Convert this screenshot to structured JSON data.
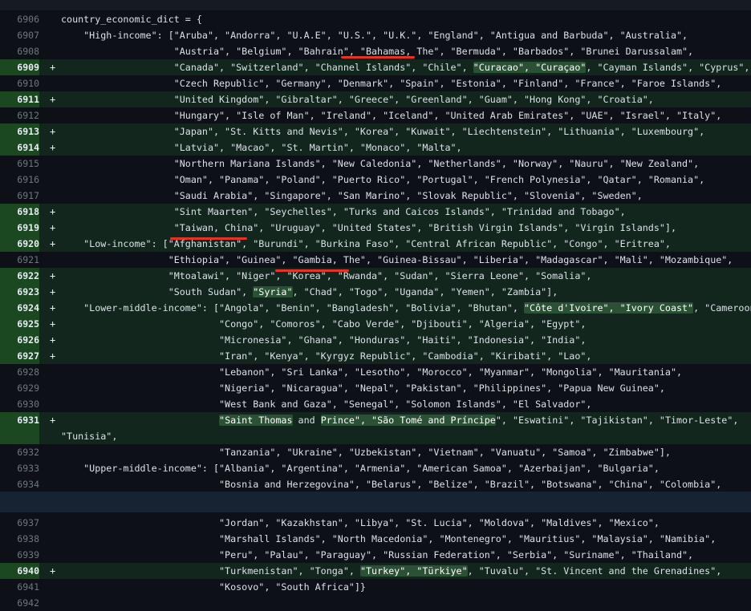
{
  "theme": {
    "bg": "#0d1117",
    "added_row_bg": "#12261e",
    "added_gutter_bg": "#1b4721",
    "inline_highlight_bg": "#2a5134",
    "line_number_color": "#6e7681",
    "underline_color": "#e5332a"
  },
  "add_marker": "+",
  "lines": [
    {
      "n": "6906",
      "add": false,
      "s": [
        {
          "t": "country_economic_dict = {"
        }
      ]
    },
    {
      "n": "6907",
      "add": false,
      "s": [
        {
          "t": "    \"High-income\": [\"Aruba\", \"Andorra\", \"U.A.E\", \"U.S.\", \"U.K.\", \"England\", \"Antigua and Barbuda\", \"Australia\","
        }
      ]
    },
    {
      "n": "6908",
      "add": false,
      "s": [
        {
          "t": "                    \"Austria\", \"Belgium\", \"Bahrain\", \"Bahamas, The\", \"Bermuda\", \"Barbados\", \"Brunei Darussalam\","
        }
      ]
    },
    {
      "n": "6909",
      "add": true,
      "s": [
        {
          "t": "                    \"Canada\", \"Switzerland\", \"Channel Islands\", \"Chile\", "
        },
        {
          "t": "\"Curacao\", \"Curaçao\"",
          "h": true
        },
        {
          "t": ", \"Cayman Islands\", \"Cyprus\","
        }
      ]
    },
    {
      "n": "6910",
      "add": false,
      "s": [
        {
          "t": "                    \"Czech Republic\", \"Germany\", \"Denmark\", \"Spain\", \"Estonia\", \"Finland\", \"France\", \"Faroe Islands\","
        }
      ]
    },
    {
      "n": "6911",
      "add": true,
      "s": [
        {
          "t": "                    \"United Kingdom\", \"Gibraltar\", \"Greece\", \"Greenland\", \"Guam\", \"Hong Kong\", \"Croatia\","
        }
      ]
    },
    {
      "n": "6912",
      "add": false,
      "s": [
        {
          "t": "                    \"Hungary\", \"Isle of Man\", \"Ireland\", \"Iceland\", \"United Arab Emirates\", \"UAE\", \"Israel\", \"Italy\","
        }
      ]
    },
    {
      "n": "6913",
      "add": true,
      "s": [
        {
          "t": "                    \"Japan\", \"St. Kitts and Nevis\", \"Korea\", \"Kuwait\", \"Liechtenstein\", \"Lithuania\", \"Luxembourg\","
        }
      ]
    },
    {
      "n": "6914",
      "add": true,
      "s": [
        {
          "t": "                    \"Latvia\", \"Macao\", \"St. Martin\", \"Monaco\", \"Malta\","
        }
      ]
    },
    {
      "n": "6915",
      "add": false,
      "s": [
        {
          "t": "                    \"Northern Mariana Islands\", \"New Caledonia\", \"Netherlands\", \"Norway\", \"Nauru\", \"New Zealand\","
        }
      ]
    },
    {
      "n": "6916",
      "add": false,
      "s": [
        {
          "t": "                    \"Oman\", \"Panama\", \"Poland\", \"Puerto Rico\", \"Portugal\", \"French Polynesia\", \"Qatar\", \"Romania\","
        }
      ]
    },
    {
      "n": "6917",
      "add": false,
      "s": [
        {
          "t": "                    \"Saudi Arabia\", \"Singapore\", \"San Marino\", \"Slovak Republic\", \"Slovenia\", \"Sweden\","
        }
      ]
    },
    {
      "n": "6918",
      "add": true,
      "s": [
        {
          "t": "                    \"Sint Maarten\", \"Seychelles\", \"Turks and Caicos Islands\", \"Trinidad and Tobago\","
        }
      ]
    },
    {
      "n": "6919",
      "add": true,
      "s": [
        {
          "t": "                    \"Taiwan, China\", \"Uruguay\", \"United States\", \"British Virgin Islands\", \"Virgin Islands\"],"
        }
      ]
    },
    {
      "n": "6920",
      "add": true,
      "s": [
        {
          "t": "    \"Low-income\": [\"Afghanistan\", \"Burundi\", \"Burkina Faso\", \"Central African Republic\", \"Congo\", \"Eritrea\","
        }
      ]
    },
    {
      "n": "6921",
      "add": false,
      "s": [
        {
          "t": "                   \"Ethiopia\", \"Guinea\", \"Gambia, The\", \"Guinea-Bissau\", \"Liberia\", \"Madagascar\", \"Mali\", \"Mozambique\","
        }
      ]
    },
    {
      "n": "6922",
      "add": true,
      "s": [
        {
          "t": "                   \"Mtoalawi\", \"Niger\", \"Korea\", \"Rwanda\", \"Sudan\", \"Sierra Leone\", \"Somalia\","
        }
      ]
    },
    {
      "n": "6923",
      "add": true,
      "s": [
        {
          "t": "                   \"South Sudan\", "
        },
        {
          "t": "\"Syria\"",
          "h": true
        },
        {
          "t": ", \"Chad\", \"Togo\", \"Uganda\", \"Yemen\", \"Zambia\"],"
        }
      ]
    },
    {
      "n": "6924",
      "add": true,
      "s": [
        {
          "t": "    \"Lower-middle-income\": [\"Angola\", \"Benin\", \"Bangladesh\", \"Bolivia\", \"Bhutan\", "
        },
        {
          "t": "\"Côte d'Ivoire\", \"Ivory Coast\"",
          "h": true
        },
        {
          "t": ", \"Cameroon\","
        }
      ]
    },
    {
      "n": "6925",
      "add": true,
      "s": [
        {
          "t": "                            \"Congo\", \"Comoros\", \"Cabo Verde\", \"Djibouti\", \"Algeria\", \"Egypt\","
        }
      ]
    },
    {
      "n": "6926",
      "add": true,
      "s": [
        {
          "t": "                            \"Micronesia\", \"Ghana\", \"Honduras\", \"Haiti\", \"Indonesia\", \"India\","
        }
      ]
    },
    {
      "n": "6927",
      "add": true,
      "s": [
        {
          "t": "                            \"Iran\", \"Kenya\", \"Kyrgyz Republic\", \"Cambodia\", \"Kiribati\", \"Lao\","
        }
      ]
    },
    {
      "n": "6928",
      "add": false,
      "s": [
        {
          "t": "                            \"Lebanon\", \"Sri Lanka\", \"Lesotho\", \"Morocco\", \"Myanmar\", \"Mongolia\", \"Mauritania\","
        }
      ]
    },
    {
      "n": "6929",
      "add": false,
      "s": [
        {
          "t": "                            \"Nigeria\", \"Nicaragua\", \"Nepal\", \"Pakistan\", \"Philippines\", \"Papua New Guinea\","
        }
      ]
    },
    {
      "n": "6930",
      "add": false,
      "s": [
        {
          "t": "                            \"West Bank and Gaza\", \"Senegal\", \"Solomon Islands\", \"El Salvador\","
        }
      ]
    },
    {
      "n": "6931",
      "add": true,
      "s": [
        {
          "t": "                            "
        },
        {
          "t": "\"Saint Thomas",
          "h": true
        },
        {
          "t": " and "
        },
        {
          "t": "Prince\", \"São Tomé and Príncipe",
          "h": true
        },
        {
          "t": "\", \"Eswatini\", \"Tajikistan\", \"Timor-Leste\","
        }
      ]
    },
    {
      "n": "",
      "add": true,
      "s": [
        {
          "t": "\"Tunisia\","
        }
      ]
    },
    {
      "n": "6932",
      "add": false,
      "s": [
        {
          "t": "                            \"Tanzania\", \"Ukraine\", \"Uzbekistan\", \"Vietnam\", \"Vanuatu\", \"Samoa\", \"Zimbabwe\"],"
        }
      ]
    },
    {
      "n": "6933",
      "add": false,
      "s": [
        {
          "t": "    \"Upper-middle-income\": [\"Albania\", \"Argentina\", \"Armenia\", \"American Samoa\", \"Azerbaijan\", \"Bulgaria\","
        }
      ]
    },
    {
      "n": "6934",
      "add": false,
      "s": [
        {
          "t": "                            \"Bosnia and Herzegovina\", \"Belarus\", \"Belize\", \"Brazil\", \"Botswana\", \"China\", \"Colombia\","
        }
      ]
    },
    {
      "n": "6937",
      "add": false,
      "s": [
        {
          "t": "                            \"Jordan\", \"Kazakhstan\", \"Libya\", \"St. Lucia\", \"Moldova\", \"Maldives\", \"Mexico\","
        }
      ]
    },
    {
      "n": "6938",
      "add": false,
      "s": [
        {
          "t": "                            \"Marshall Islands\", \"North Macedonia\", \"Montenegro\", \"Mauritius\", \"Malaysia\", \"Namibia\","
        }
      ]
    },
    {
      "n": "6939",
      "add": false,
      "s": [
        {
          "t": "                            \"Peru\", \"Palau\", \"Paraguay\", \"Russian Federation\", \"Serbia\", \"Suriname\", \"Thailand\","
        }
      ]
    },
    {
      "n": "6940",
      "add": true,
      "s": [
        {
          "t": "                            \"Turkmenistan\", \"Tonga\", "
        },
        {
          "t": "\"Turkey\", \"Türkiye\"",
          "h": true
        },
        {
          "t": ", \"Tuvalu\", \"St. Vincent and the Grenadines\","
        }
      ]
    },
    {
      "n": "6941",
      "add": false,
      "s": [
        {
          "t": "                            \"Kosovo\", \"South Africa\"]}"
        }
      ]
    },
    {
      "n": "6942",
      "add": false,
      "s": [
        {
          "t": ""
        }
      ]
    }
  ]
}
